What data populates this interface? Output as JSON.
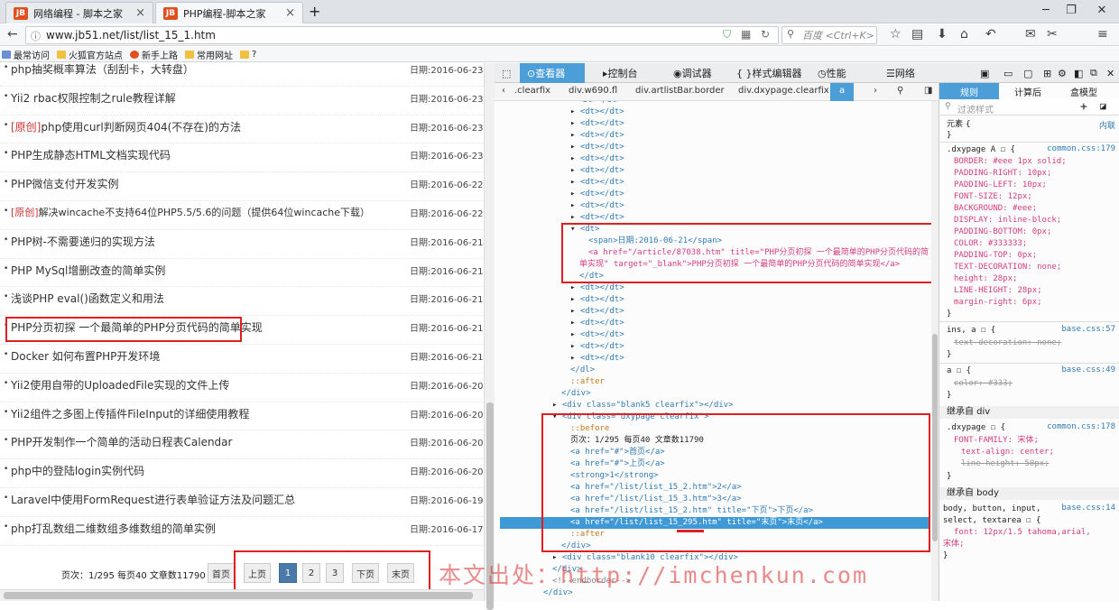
{
  "browser": {
    "tabs": [
      {
        "label": "网络编程 - 脚本之家"
      },
      {
        "label": "PHP编程-脚本之家"
      }
    ],
    "new_tab": "+",
    "url": "www.jb51.net/list/list_15_1.htm",
    "search_placeholder": "百度 <Ctrl+K>",
    "bookmarks": [
      "最常访问",
      "火狐官方站点",
      "新手上路",
      "常用网址",
      "?"
    ]
  },
  "articles": [
    {
      "prefix": "",
      "title": "php抽奖概率算法（刮刮卡，大转盘）",
      "date": "日期:2016-06-23"
    },
    {
      "prefix": "",
      "title": "Yii2 rbac权限控制之rule教程详解",
      "date": "日期:2016-06-23"
    },
    {
      "prefix": "[原创]",
      "title": "php使用curl判断网页404(不存在)的方法",
      "date": "日期:2016-06-23"
    },
    {
      "prefix": "",
      "title": "PHP生成静态HTML文档实现代码",
      "date": "日期:2016-06-23"
    },
    {
      "prefix": "",
      "title": "PHP微信支付开发实例",
      "date": "日期:2016-06-22"
    },
    {
      "prefix": "[原创]",
      "title": "解决wincache不支持64位PHP5.5/5.6的问题（提供64位wincache下载）",
      "date": "日期:2016-06-22"
    },
    {
      "prefix": "",
      "title": "PHP树-不需要递归的实现方法",
      "date": "日期:2016-06-21"
    },
    {
      "prefix": "",
      "title": "PHP MySql增删改查的简单实例",
      "date": "日期:2016-06-21"
    },
    {
      "prefix": "",
      "title": "浅谈PHP eval()函数定义和用法",
      "date": "日期:2016-06-21"
    },
    {
      "prefix": "",
      "title": "PHP分页初探 一个最简单的PHP分页代码的简单实现",
      "date": "日期:2016-06-21"
    },
    {
      "prefix": "",
      "title": "Docker 如何布置PHP开发环境",
      "date": "日期:2016-06-21"
    },
    {
      "prefix": "",
      "title": "Yii2使用自带的UploadedFile实现的文件上传",
      "date": "日期:2016-06-20"
    },
    {
      "prefix": "",
      "title": "Yii2组件之多图上传插件FileInput的详细使用教程",
      "date": "日期:2016-06-20"
    },
    {
      "prefix": "",
      "title": "PHP开发制作一个简单的活动日程表Calendar",
      "date": "日期:2016-06-20"
    },
    {
      "prefix": "",
      "title": "php中的登陆login实例代码",
      "date": "日期:2016-06-20"
    },
    {
      "prefix": "",
      "title": "Laravel中使用FormRequest进行表单验证方法及问题汇总",
      "date": "日期:2016-06-19"
    },
    {
      "prefix": "",
      "title": "php打乱数组二维数组多维数组的简单实例",
      "date": "日期:2016-06-17"
    }
  ],
  "pager": {
    "info": "页次：1/295 每页40 文章数11790",
    "first": "首页",
    "prev": "上页",
    "p1": "1",
    "p2": "2",
    "p3": "3",
    "next": "下页",
    "last": "末页"
  },
  "devtools": {
    "tabs": [
      "查看器",
      "控制台",
      "调试器",
      "样式编辑器",
      "性能",
      "网络"
    ],
    "breadcrumbs": [
      ".clearfix",
      "div.w690.fl",
      "div.artlistBar.border",
      "div.dxypage.clearfix",
      "a"
    ],
    "rule_tabs": [
      "规则",
      "计算后",
      "盒模型"
    ],
    "filter_placeholder": "过滤样式",
    "markup": {
      "dt": "<dt></dt>",
      "dt_open": "<dt>",
      "dt_close": "</dt>",
      "span_line": "<span>日期:2016-06-21</span>",
      "a_line1": "<a href=\"/article/87038.htm\" title=\"PHP分页初探 一个最简单的PHP分页代码的简",
      "a_line2": "单实现\" target=\"_blank\">PHP分页初探 一个最简单的PHP分页代码的简单实现</a>",
      "dl_close": "</dl>",
      "after": "::after",
      "div_close": "</div>",
      "blank5": "<div class=\"blank5 clearfix\"></div>",
      "dxypage_open": "<div class=\"dxypage clearfix\">",
      "before": "::before",
      "page_text": "页次：1/295 每页40 文章数11790",
      "a_first": "<a href=\"#\">首页</a>",
      "a_prev": "<a href=\"#\">上页</a>",
      "strong": "<strong>1</strong>",
      "a_2": "<a href=\"/list/list_15_2.htm\">2</a>",
      "a_3": "<a href=\"/list/list_15_3.htm\">3</a>",
      "a_next": "<a href=\"/list/list_15_2.htm\" title=\"下页\">下页</a>",
      "a_last": "<a href=\"/list/list_15_295.htm\" title=\"末页\">末页</a>",
      "blank10": "<div class=\"blank10 clearfix\"></div>",
      "endborder": "<!--endborder-->"
    },
    "rules": {
      "element": "元素 {",
      "inline": "内联",
      "close": "}",
      "sel1": ".dxypage A",
      "file1": "common.css:179",
      "props1": [
        "BORDER: #eee 1px solid;",
        "PADDING-RIGHT: 10px;",
        "PADDING-LEFT: 10px;",
        "FONT-SIZE: 12px;",
        "BACKGROUND: #eee;",
        "DISPLAY: inline-block;",
        "PADDING-BOTTOM: 0px;",
        "COLOR: #333333;",
        "PADDING-TOP: 0px;",
        "TEXT-DECORATION: none;",
        "height: 28px;",
        "LINE-HEIGHT: 28px;",
        "margin-right: 6px;"
      ],
      "sel2": "ins, a",
      "file2": "base.css:57",
      "prop2": "text-decoration: none;",
      "sel3": "a",
      "file3": "base.css:49",
      "prop3": "color: #333;",
      "inherit1": "继承自 div",
      "sel4": ".dxypage",
      "file4": "common.css:178",
      "props4": [
        "FONT-FAMILY: 宋体;",
        "text-align: center;",
        "line-height: 50px;"
      ],
      "inherit2": "继承自 body",
      "sel5a": "body, button, input,",
      "sel5b": "select, textarea",
      "file5": "base.css:14",
      "prop5a": "font: 12px/1.5 tahoma,arial,",
      "prop5b": "宋体;"
    }
  },
  "watermark": "本文出处：http://imchenkun.com"
}
